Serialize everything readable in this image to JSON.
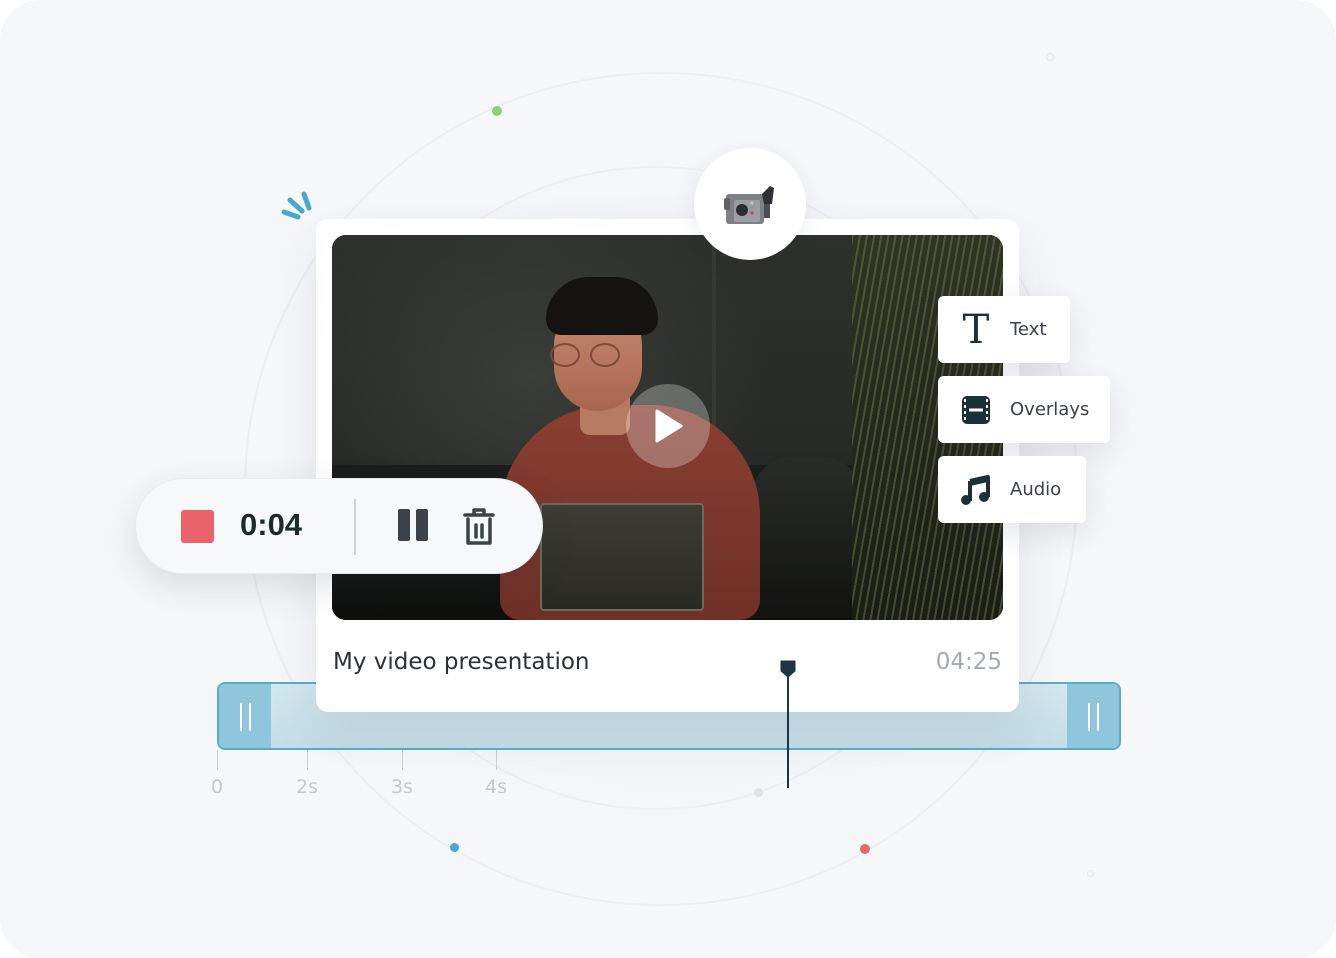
{
  "video": {
    "title": "My video presentation",
    "duration": "04:25",
    "play_icon": "play-icon",
    "camera_icon": "video-camera-icon"
  },
  "recorder": {
    "elapsed": "0:04",
    "stop_icon": "stop-icon",
    "pause_icon": "pause-icon",
    "delete_icon": "trash-icon",
    "stop_color": "#e8646a"
  },
  "tools": [
    {
      "label": "Text",
      "icon": "text-icon"
    },
    {
      "label": "Overlays",
      "icon": "film-strip-icon"
    },
    {
      "label": "Audio",
      "icon": "music-note-icon"
    }
  ],
  "timeline": {
    "ticks": [
      "0",
      "2s",
      "3s",
      "4s"
    ],
    "accent": "#5aaccb",
    "handle_color": "#8fc6db"
  },
  "decor": {
    "dot_colors": [
      "#8fcf77",
      "#4aa7c9",
      "#e8676b"
    ]
  }
}
